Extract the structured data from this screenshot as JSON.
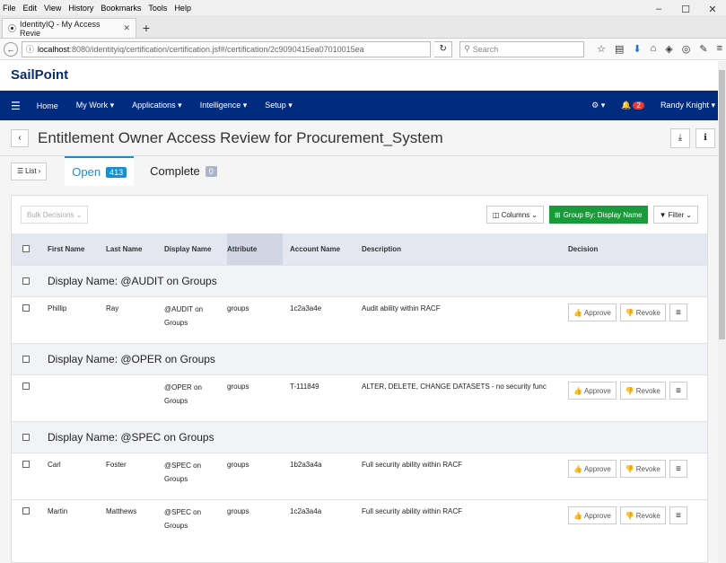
{
  "browser": {
    "menu": [
      "File",
      "Edit",
      "View",
      "History",
      "Bookmarks",
      "Tools",
      "Help"
    ],
    "tab_title": "IdentityIQ - My Access Revie",
    "url_host": "localhost",
    "url_path": ":8080/identityiq/certification/certification.jsf#/certification/2c9090415ea07010015ea",
    "search_placeholder": "Search"
  },
  "app": {
    "logo": "SailPoint",
    "nav": [
      "Home",
      "My Work ▾",
      "Applications ▾",
      "Intelligence ▾",
      "Setup ▾"
    ],
    "notifications": "2",
    "user": "Randy Knight ▾"
  },
  "page": {
    "title": "Entitlement Owner Access Review for Procurement_System",
    "list_label": "List",
    "tabs": [
      {
        "label": "Open",
        "count": "413"
      },
      {
        "label": "Complete",
        "count": "0"
      }
    ]
  },
  "toolbar": {
    "bulk": "Bulk Decisions",
    "columns": "Columns",
    "group_by": "Group By: Display Name",
    "filter": "Filter"
  },
  "columns": [
    "First Name",
    "Last Name",
    "Display Name",
    "Attribute",
    "Account Name",
    "Description",
    "Decision"
  ],
  "actions": {
    "approve": "Approve",
    "revoke": "Revoke"
  },
  "groups": [
    {
      "title": "Display Name: @AUDIT on Groups"
    },
    {
      "title": "Display Name: @OPER on Groups"
    },
    {
      "title": "Display Name: @SPEC on Groups"
    }
  ],
  "rows": [
    {
      "first": "Phillip",
      "last": "Ray",
      "display1": "@AUDIT on",
      "display2": "Groups",
      "attribute": "groups",
      "account": "1c2a3a4e",
      "description": "Audit ability within RACF"
    },
    {
      "first": "",
      "last": "",
      "display1": "@OPER on",
      "display2": "Groups",
      "attribute": "groups",
      "account": "T-111849",
      "description": "ALTER, DELETE, CHANGE DATASETS - no security func"
    },
    {
      "first": "Carl",
      "last": "Foster",
      "display1": "@SPEC on",
      "display2": "Groups",
      "attribute": "groups",
      "account": "1b2a3a4a",
      "description": "Full security ability within RACF"
    },
    {
      "first": "Martin",
      "last": "Matthews",
      "display1": "@SPEC on",
      "display2": "Groups",
      "attribute": "groups",
      "account": "1c2a3a4a",
      "description": "Full security ability within RACF"
    }
  ]
}
